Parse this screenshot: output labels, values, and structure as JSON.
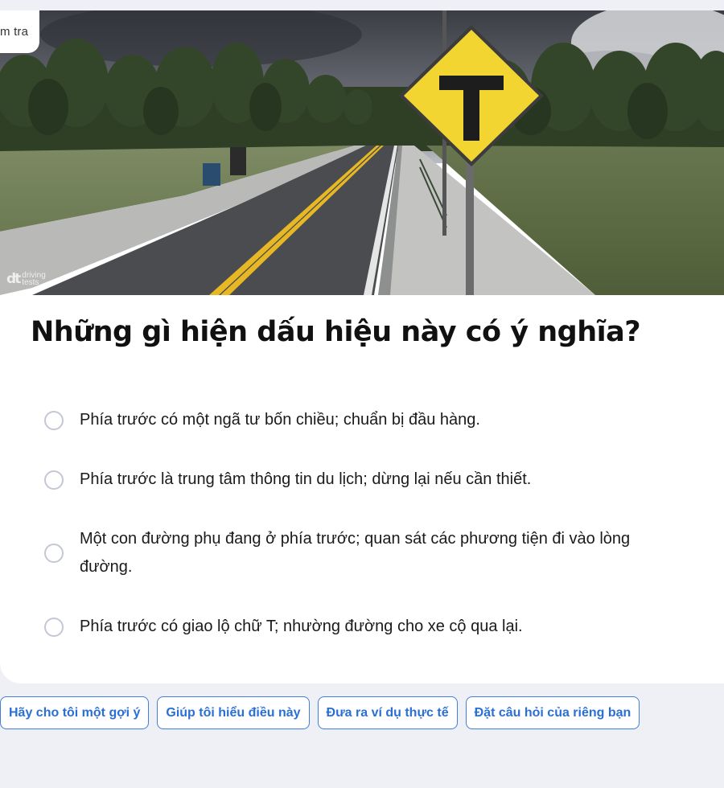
{
  "header": {
    "tab_label": "m tra"
  },
  "image": {
    "watermark_text": "driving tests",
    "watermark_logo": "dt"
  },
  "question": {
    "text": "Những gì hiện dấu hiệu này có ý nghĩa?"
  },
  "options": [
    {
      "text": "Phía trước có một ngã tư bốn chiều; chuẩn bị đầu hàng."
    },
    {
      "text": "Phía trước là trung tâm thông tin du lịch; dừng lại nếu cần thiết."
    },
    {
      "text": "Một con đường phụ đang ở phía trước; quan sát các phương tiện đi vào lòng đường."
    },
    {
      "text": "Phía trước có giao lộ chữ T; nhường đường cho xe cộ qua lại."
    }
  ],
  "chips": [
    {
      "label": "Hãy cho tôi một gợi ý"
    },
    {
      "label": "Giúp tôi hiểu điều này"
    },
    {
      "label": "Đưa ra ví dụ thực tế"
    },
    {
      "label": "Đặt câu hỏi của riêng bạn"
    }
  ],
  "colors": {
    "accent": "#2a6fd6",
    "sign_yellow": "#f2d530",
    "page_bg": "#eff0f5"
  },
  "icons": {
    "road_sign": "t-junction-sign-icon"
  }
}
